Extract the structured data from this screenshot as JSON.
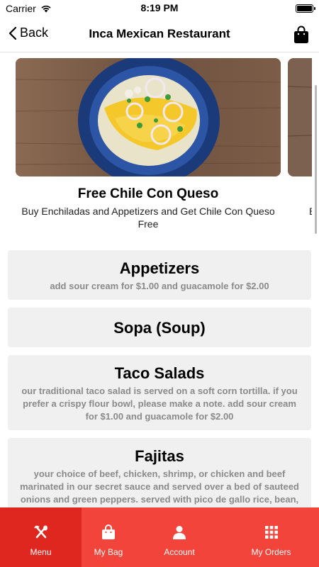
{
  "status_bar": {
    "carrier": "Carrier",
    "time": "8:19 PM"
  },
  "nav": {
    "back_label": "Back",
    "title": "Inca Mexican Restaurant"
  },
  "promos": [
    {
      "title": "Free Chile Con Queso",
      "description": "Buy Enchiladas and Appetizers and Get Chile Con Queso Free"
    }
  ],
  "next_promo_stub": "B",
  "categories": [
    {
      "name": "Appetizers",
      "description": "add sour cream for $1.00 and guacamole for $2.00"
    },
    {
      "name": "Sopa (Soup)",
      "description": ""
    },
    {
      "name": "Taco Salads",
      "description": "our traditional taco salad is served on a soft corn tortilla. if you prefer a crispy flour bowl, please make a note. add sour cream for $1.00 and guacamole for $2.00"
    },
    {
      "name": "Fajitas",
      "description": "your choice of beef, chicken, shrimp, or chicken and beef marinated in our secret sauce and served over a bed of sauteed onions and green peppers. served with pico de gallo rice, bean,"
    }
  ],
  "tabs": [
    {
      "label": "Menu",
      "icon": "fork-knife-icon",
      "active": true
    },
    {
      "label": "My Bag",
      "icon": "bag-icon",
      "active": false
    },
    {
      "label": "Account",
      "icon": "person-icon",
      "active": false
    },
    {
      "label": "My Orders",
      "icon": "grid-icon",
      "active": false
    }
  ],
  "colors": {
    "tab_bar": "#f2443a",
    "tab_active": "#e0271f",
    "card_bg": "#f0f0f0"
  }
}
